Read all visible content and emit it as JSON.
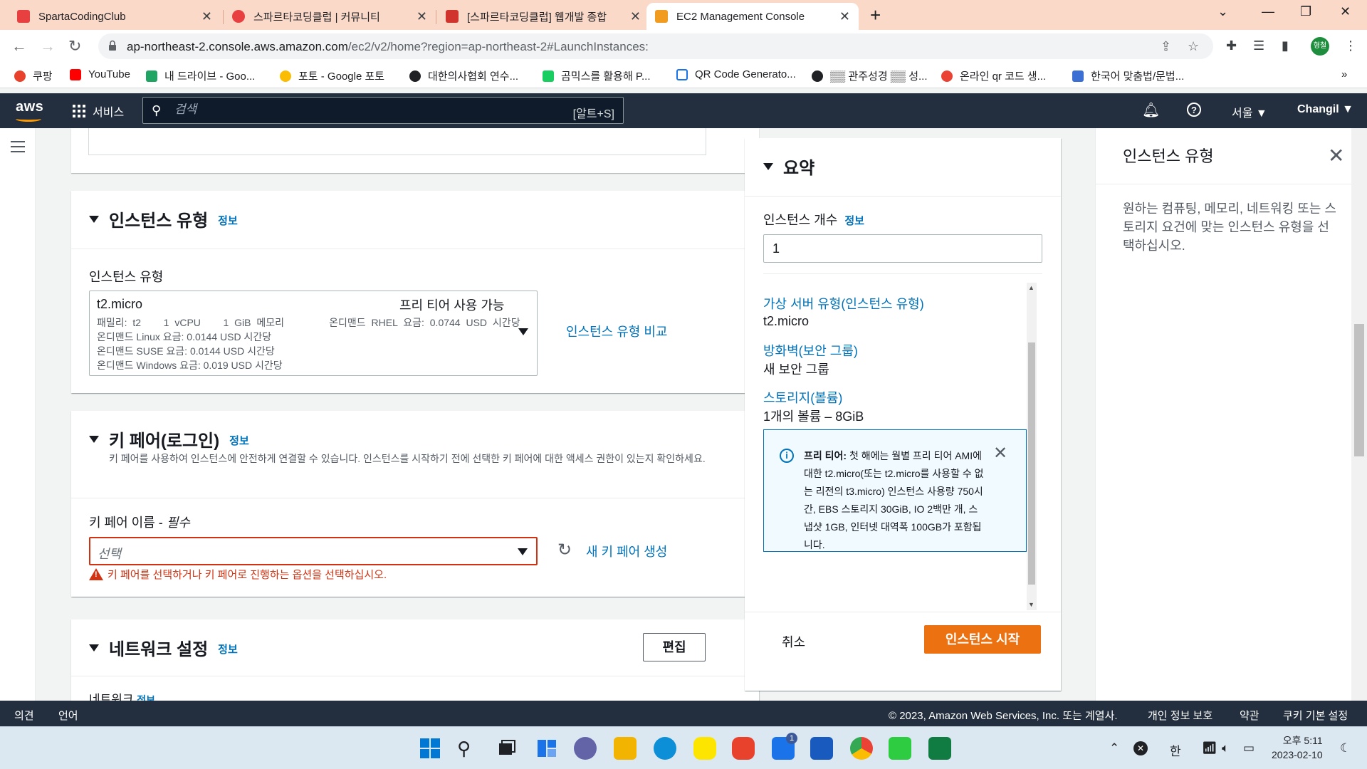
{
  "browser": {
    "tabs": [
      {
        "label": "SpartaCodingClub",
        "color": "#e84040"
      },
      {
        "label": "스파르타코딩클럽 | 커뮤니티",
        "color": "#e84040"
      },
      {
        "label": "[스파르타코딩클럽] 웹개발 종합",
        "color": "#d0342c"
      },
      {
        "label": "EC2 Management Console",
        "color": "#f29c1f"
      }
    ],
    "new_tab_icon": "plus-icon",
    "url_host": "ap-northeast-2.console.aws.amazon.com",
    "url_path": "/ec2/v2/home?region=ap-northeast-2#LaunchInstances:",
    "profile_label": "형철",
    "bookmarks": [
      {
        "label": "쿠팡",
        "color": "#e8412c"
      },
      {
        "label": "YouTube",
        "color": "#ff0000"
      },
      {
        "label": "내 드라이브 - Goo...",
        "color": "#1fa463"
      },
      {
        "label": "포토 - Google 포토",
        "color": "#fbbc04"
      },
      {
        "label": "대한의사협회 연수...",
        "color": "#202124"
      },
      {
        "label": "곰믹스를 활용해 P...",
        "color": "#19ce60"
      },
      {
        "label": "QR Code Generato...",
        "color": "#1a73e8"
      },
      {
        "label": "▒▒ 관주성경 ▒▒ 성...",
        "color": "#202124"
      },
      {
        "label": "온라인 qr 코드 생...",
        "color": "#ea4335"
      },
      {
        "label": "한국어 맞춤법/문법...",
        "color": "#3b6fd4"
      }
    ],
    "bookmarks_more": "»"
  },
  "aws_header": {
    "logo": "aws",
    "services_label": "서비스",
    "search_placeholder": "검색",
    "search_hint": "[알트+S]",
    "region": "서울 ▼",
    "user": "Changil ▼"
  },
  "instance_type_section": {
    "title": "인스턴스 유형",
    "info": "정보",
    "field_label": "인스턴스 유형",
    "selected": {
      "name": "t2.micro",
      "badge": "프리 티어 사용 가능",
      "spec_line1": "패밀리: t2    1 vCPU    1 GiB 메모리        온디맨드 RHEL 요금: 0.0744 USD 시간당",
      "spec_line2": "온디맨드 Linux 요금: 0.0144 USD 시간당",
      "spec_line3": "온디맨드 SUSE 요금: 0.0144 USD 시간당",
      "spec_line4": "온디맨드 Windows 요금: 0.019 USD 시간당"
    },
    "compare_link": "인스턴스 유형 비교"
  },
  "key_pair_section": {
    "title": "키 페어(로그인)",
    "info": "정보",
    "description": "키 페어를 사용하여 인스턴스에 안전하게 연결할 수 있습니다. 인스턴스를 시작하기 전에 선택한 키 페어에 대한 액세스 권한이 있는지 확인하세요.",
    "field_label": "키 페어 이름 - ",
    "field_required": "필수",
    "placeholder": "선택",
    "error": "키 페어를 선택하거나 키 페어로 진행하는 옵션을 선택하십시오.",
    "create_link": "새 키 페어 생성"
  },
  "network_section": {
    "title": "네트워크 설정",
    "info": "정보",
    "edit_button": "편집",
    "sub_label": "네트워크",
    "sub_info": "정보"
  },
  "summary": {
    "title": "요약",
    "count_label": "인스턴스 개수",
    "count_info": "정보",
    "count_value": "1",
    "server_type_link": "가상 서버 유형(인스턴스 유형)",
    "server_type_value": "t2.micro",
    "firewall_link": "방화벽(보안 그룹)",
    "firewall_value": "새 보안 그룹",
    "storage_link": "스토리지(볼륨)",
    "storage_value": "1개의 볼륨 – 8GiB",
    "free_tier_title": "프리 티어:",
    "free_tier_text": " 첫 해에는 월별 프리 티어 AMI에 대한 t2.micro(또는 t2.micro를 사용할 수 없는 리전의 t3.micro) 인스턴스 사용량 750시간, EBS 스토리지 30GiB, IO 2백만 개, 스냅샷 1GB, 인터넷 대역폭 100GB가 포함됩니다.",
    "cancel_button": "취소",
    "launch_button": "인스턴스 시작"
  },
  "help_panel": {
    "title": "인스턴스 유형",
    "body": "원하는 컴퓨팅, 메모리, 네트워킹 또는 스토리지 요건에 맞는 인스턴스 유형을 선택하십시오."
  },
  "aws_footer": {
    "feedback": "의견",
    "language": "언어",
    "copyright": "© 2023, Amazon Web Services, Inc. 또는 계열사.",
    "privacy": "개인 정보 보호",
    "terms": "약관",
    "cookies": "쿠키 기본 설정"
  },
  "taskbar": {
    "ime": "한",
    "time": "오후 5:11",
    "date": "2023-02-10",
    "apps": [
      {
        "name": "windows-start-icon",
        "color": "#0078d4"
      },
      {
        "name": "search-icon",
        "color": "#202124"
      },
      {
        "name": "task-view-icon",
        "color": "#202124"
      },
      {
        "name": "widgets-icon",
        "color": "#1a73e8"
      },
      {
        "name": "teams-chat-icon",
        "color": "#6264a7"
      },
      {
        "name": "file-explorer-icon",
        "color": "#f2b400"
      },
      {
        "name": "edge-icon",
        "color": "#0c8fd6"
      },
      {
        "name": "kakaotalk-icon",
        "color": "#fee500"
      },
      {
        "name": "record-app-icon",
        "color": "#e8412c"
      },
      {
        "name": "phone-link-icon",
        "color": "#1a73e8"
      },
      {
        "name": "word-icon",
        "color": "#185abd"
      },
      {
        "name": "chrome-icon",
        "color": "#34a853"
      },
      {
        "name": "vim-icon",
        "color": "#2ecc40"
      },
      {
        "name": "excel-icon",
        "color": "#107c41"
      }
    ],
    "phone_badge": "1"
  },
  "colors": {
    "aws_nav": "#232f3e",
    "primary_button": "#ec7211",
    "link": "#0073bb",
    "error": "#d13212"
  }
}
